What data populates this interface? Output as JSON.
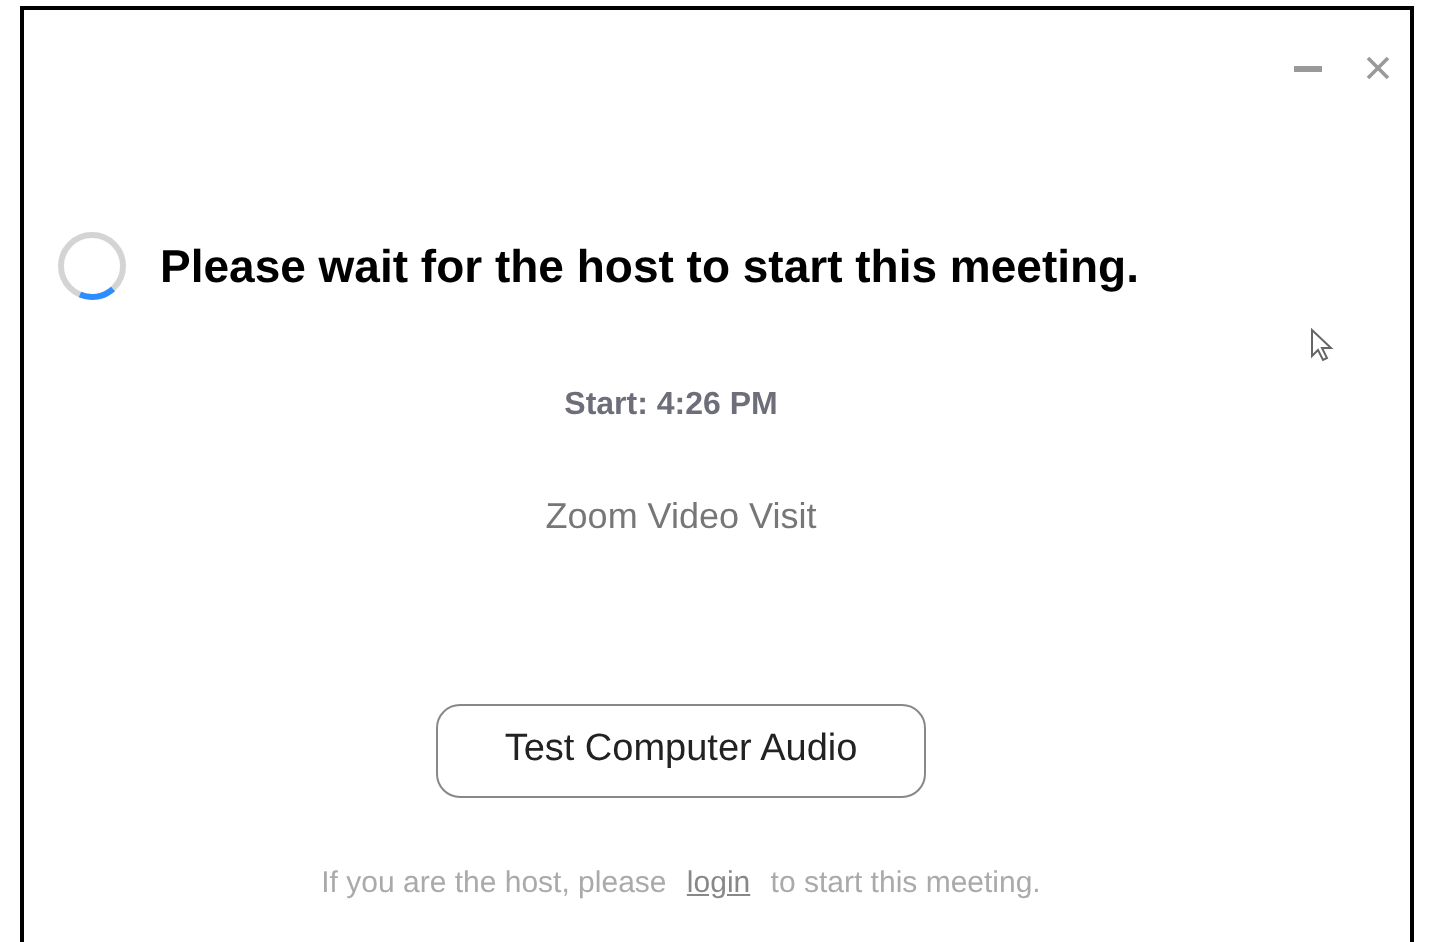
{
  "heading": "Please wait for the host to start this meeting.",
  "start_time": "Start: 4:26 PM",
  "meeting_topic": "Zoom Video Visit",
  "button": "Test Computer Audio",
  "footer": {
    "before": "If you are the host, please",
    "link": "login",
    "after": "to start this meeting."
  }
}
